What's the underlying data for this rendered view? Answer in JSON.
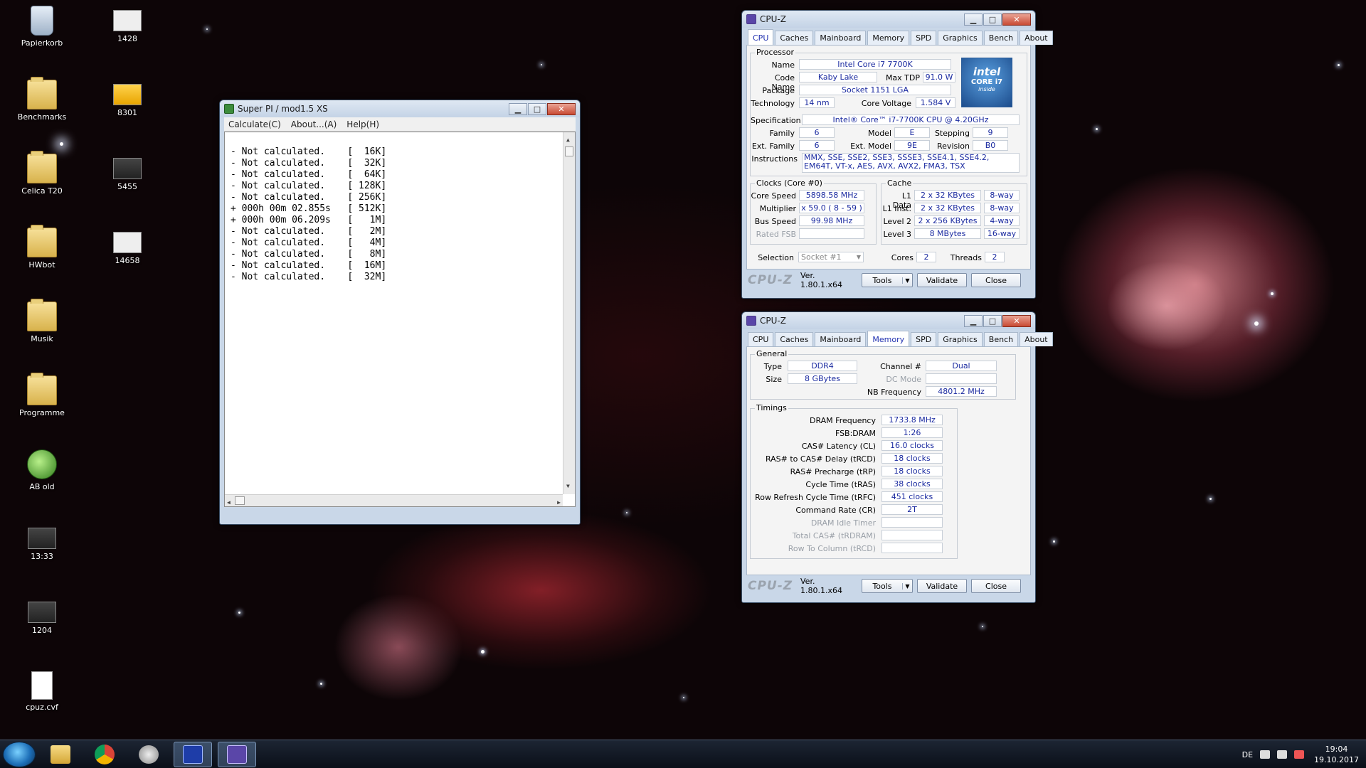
{
  "desktop_icons": [
    {
      "label": "Papierkorb",
      "icon": "recycle-bin-icon"
    },
    {
      "label": "1428",
      "icon": "image-file-icon"
    },
    {
      "label": "Benchmarks",
      "icon": "folder-icon"
    },
    {
      "label": "8301",
      "icon": "image-file-icon"
    },
    {
      "label": "Celica T20",
      "icon": "folder-icon"
    },
    {
      "label": "5455",
      "icon": "image-file-icon"
    },
    {
      "label": "HWbot",
      "icon": "folder-icon"
    },
    {
      "label": "14658",
      "icon": "image-file-icon"
    },
    {
      "label": "Musik",
      "icon": "folder-icon"
    },
    {
      "label": "Programme",
      "icon": "folder-icon"
    },
    {
      "label": "AB old",
      "icon": "shortcut-icon"
    },
    {
      "label": "13:33",
      "icon": "image-file-icon"
    },
    {
      "label": "1204",
      "icon": "image-file-icon"
    },
    {
      "label": "cpuz.cvf",
      "icon": "text-file-icon"
    }
  ],
  "superpi": {
    "title": "Super PI / mod1.5 XS",
    "menu": [
      "Calculate(C)",
      "About...(A)",
      "Help(H)"
    ],
    "lines": [
      "- Not calculated.    [  16K]",
      "- Not calculated.    [  32K]",
      "- Not calculated.    [  64K]",
      "- Not calculated.    [ 128K]",
      "- Not calculated.    [ 256K]",
      "+ 000h 00m 02.855s   [ 512K]",
      "+ 000h 00m 06.209s   [   1M]",
      "- Not calculated.    [   2M]",
      "- Not calculated.    [   4M]",
      "- Not calculated.    [   8M]",
      "- Not calculated.    [  16M]",
      "- Not calculated.    [  32M]"
    ]
  },
  "cpuz_cpu": {
    "title": "CPU-Z",
    "tabs": [
      "CPU",
      "Caches",
      "Mainboard",
      "Memory",
      "SPD",
      "Graphics",
      "Bench",
      "About"
    ],
    "active_tab": "CPU",
    "processor_group": "Processor",
    "name_label": "Name",
    "name": "Intel Core i7 7700K",
    "codename_label": "Code Name",
    "codename": "Kaby Lake",
    "maxtdp_label": "Max TDP",
    "maxtdp": "91.0 W",
    "package_label": "Package",
    "package": "Socket 1151 LGA",
    "technology_label": "Technology",
    "technology": "14 nm",
    "corevoltage_label": "Core Voltage",
    "corevoltage": "1.584 V",
    "spec_label": "Specification",
    "spec": "Intel® Core™ i7-7700K CPU @ 4.20GHz",
    "family_label": "Family",
    "family": "6",
    "model_label": "Model",
    "model": "E",
    "stepping_label": "Stepping",
    "stepping": "9",
    "extfamily_label": "Ext. Family",
    "extfamily": "6",
    "extmodel_label": "Ext. Model",
    "extmodel": "9E",
    "revision_label": "Revision",
    "revision": "B0",
    "instructions_label": "Instructions",
    "instructions": "MMX, SSE, SSE2, SSE3, SSSE3, SSE4.1, SSE4.2, EM64T, VT-x, AES, AVX, AVX2, FMA3, TSX",
    "intel_logo": {
      "line1": "intel",
      "line2": "CORE i7",
      "line3": "inside"
    },
    "clocks_group": "Clocks (Core #0)",
    "corespeed_label": "Core Speed",
    "corespeed": "5898.58 MHz",
    "multiplier_label": "Multiplier",
    "multiplier": "x 59.0 ( 8 - 59 )",
    "busspeed_label": "Bus Speed",
    "busspeed": "99.98 MHz",
    "ratedfsb_label": "Rated FSB",
    "ratedfsb": "",
    "cache_group": "Cache",
    "l1data_label": "L1 Data",
    "l1data": "2 x 32 KBytes",
    "l1data_way": "8-way",
    "l1inst_label": "L1 Inst.",
    "l1inst": "2 x 32 KBytes",
    "l1inst_way": "8-way",
    "level2_label": "Level 2",
    "level2": "2 x 256 KBytes",
    "level2_way": "4-way",
    "level3_label": "Level 3",
    "level3": "8 MBytes",
    "level3_way": "16-way",
    "selection_label": "Selection",
    "selection": "Socket #1",
    "cores_label": "Cores",
    "cores": "2",
    "threads_label": "Threads",
    "threads": "2",
    "brand": "CPU-Z",
    "version": "Ver. 1.80.1.x64",
    "tools": "Tools",
    "validate": "Validate",
    "close": "Close"
  },
  "cpuz_mem": {
    "title": "CPU-Z",
    "tabs": [
      "CPU",
      "Caches",
      "Mainboard",
      "Memory",
      "SPD",
      "Graphics",
      "Bench",
      "About"
    ],
    "active_tab": "Memory",
    "general_group": "General",
    "type_label": "Type",
    "type": "DDR4",
    "size_label": "Size",
    "size": "8 GBytes",
    "channel_label": "Channel #",
    "channel": "Dual",
    "dcmode_label": "DC Mode",
    "dcmode": "",
    "nbfreq_label": "NB Frequency",
    "nbfreq": "4801.2 MHz",
    "timings_group": "Timings",
    "timings": [
      {
        "label": "DRAM Frequency",
        "value": "1733.8 MHz",
        "dim": false
      },
      {
        "label": "FSB:DRAM",
        "value": "1:26",
        "dim": false
      },
      {
        "label": "CAS# Latency (CL)",
        "value": "16.0 clocks",
        "dim": false
      },
      {
        "label": "RAS# to CAS# Delay (tRCD)",
        "value": "18 clocks",
        "dim": false
      },
      {
        "label": "RAS# Precharge (tRP)",
        "value": "18 clocks",
        "dim": false
      },
      {
        "label": "Cycle Time (tRAS)",
        "value": "38 clocks",
        "dim": false
      },
      {
        "label": "Row Refresh Cycle Time (tRFC)",
        "value": "451 clocks",
        "dim": false
      },
      {
        "label": "Command Rate (CR)",
        "value": "2T",
        "dim": false
      },
      {
        "label": "DRAM Idle Timer",
        "value": "",
        "dim": true
      },
      {
        "label": "Total CAS# (tRDRAM)",
        "value": "",
        "dim": true
      },
      {
        "label": "Row To Column (tRCD)",
        "value": "",
        "dim": true
      }
    ],
    "brand": "CPU-Z",
    "version": "Ver. 1.80.1.x64",
    "tools": "Tools",
    "validate": "Validate",
    "close": "Close"
  },
  "taskbar": {
    "language": "DE",
    "time": "19:04",
    "date": "19.10.2017",
    "apps": [
      "explorer-icon",
      "chrome-icon",
      "afterburner-icon",
      "superpi-icon",
      "cpuz-icon"
    ]
  },
  "colors": {
    "value_text": "#1a2aa0",
    "active_tab_text": "#2030b0",
    "desktop_bg": "#0d0507"
  }
}
